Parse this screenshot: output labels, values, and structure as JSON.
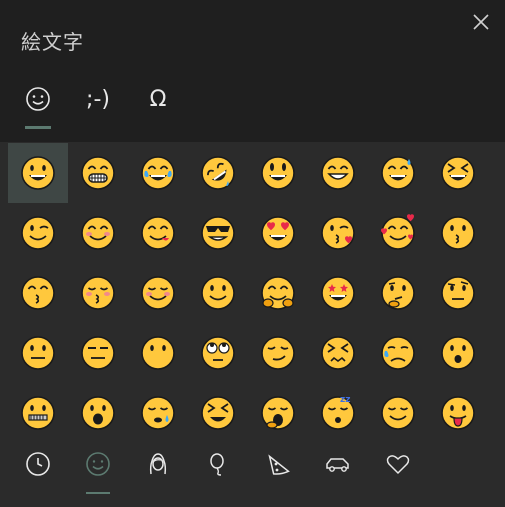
{
  "title": "絵文字",
  "top_tabs": [
    {
      "id": "emoji",
      "label": "",
      "icon": "smiley-outline-icon",
      "active": true
    },
    {
      "id": "kaomoji",
      "label": ";-)",
      "icon": "",
      "active": false
    },
    {
      "id": "symbols",
      "label": "Ω",
      "icon": "",
      "active": false
    }
  ],
  "emoji_grid": [
    "grinning-face",
    "beaming-face",
    "tears-of-joy",
    "rolling-laughing",
    "grinning-big-eyes",
    "grinning-smiling-eyes",
    "sweat-smile",
    "squinting-face",
    "winking-face",
    "smiling-eyes",
    "savoring-food",
    "sunglasses-face",
    "heart-eyes",
    "blowing-kiss",
    "smiling-hearts",
    "kissing-face",
    "kissing-smiling-eyes",
    "kissing-closed-eyes",
    "smiling-face",
    "slightly-smiling",
    "hugging-face",
    "star-struck",
    "thinking-face",
    "raised-eyebrow",
    "neutral-face",
    "expressionless-face",
    "no-mouth",
    "rolling-eyes",
    "smirking-face",
    "persevering-face",
    "sad-relieved",
    "hushed-face",
    "zipper-mouth",
    "open-mouth",
    "sleepy-face",
    "tired-face",
    "yawning-face",
    "sleeping-face",
    "relieved-face",
    "tongue-face"
  ],
  "bottom_tabs": [
    {
      "id": "recent",
      "icon": "clock-icon",
      "active": false
    },
    {
      "id": "smileys",
      "icon": "smiley-icon",
      "active": true
    },
    {
      "id": "people",
      "icon": "person-icon",
      "active": false
    },
    {
      "id": "celebration",
      "icon": "balloon-icon",
      "active": false
    },
    {
      "id": "food",
      "icon": "pizza-icon",
      "active": false
    },
    {
      "id": "travel",
      "icon": "car-icon",
      "active": false
    },
    {
      "id": "symbols",
      "icon": "heart-icon",
      "active": false
    }
  ],
  "colors": {
    "accent": "#5c7a70",
    "face": "#ffc83d",
    "outline": "#1a1a1a"
  }
}
